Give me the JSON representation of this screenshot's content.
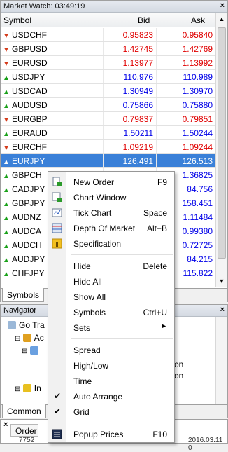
{
  "market_watch": {
    "title": "Market Watch: 03:49:19",
    "close": "×",
    "col_symbol": "Symbol",
    "col_bid": "Bid",
    "col_ask": "Ask",
    "rows": [
      {
        "symbol": "USDCHF",
        "bid": "0.95823",
        "ask": "0.95840",
        "dir": "down"
      },
      {
        "symbol": "GBPUSD",
        "bid": "1.42745",
        "ask": "1.42769",
        "dir": "down"
      },
      {
        "symbol": "EURUSD",
        "bid": "1.13977",
        "ask": "1.13992",
        "dir": "down"
      },
      {
        "symbol": "USDJPY",
        "bid": "110.976",
        "ask": "110.989",
        "dir": "up"
      },
      {
        "symbol": "USDCAD",
        "bid": "1.30949",
        "ask": "1.30970",
        "dir": "up"
      },
      {
        "symbol": "AUDUSD",
        "bid": "0.75866",
        "ask": "0.75880",
        "dir": "up"
      },
      {
        "symbol": "EURGBP",
        "bid": "0.79837",
        "ask": "0.79851",
        "dir": "down"
      },
      {
        "symbol": "EURAUD",
        "bid": "1.50211",
        "ask": "1.50244",
        "dir": "up"
      },
      {
        "symbol": "EURCHF",
        "bid": "1.09219",
        "ask": "1.09244",
        "dir": "down"
      },
      {
        "symbol": "EURJPY",
        "bid": "126.491",
        "ask": "126.513",
        "dir": "up"
      },
      {
        "symbol": "GBPCH",
        "bid": "",
        "ask": "1.36825",
        "dir": "up"
      },
      {
        "symbol": "CADJPY",
        "bid": "",
        "ask": "84.756",
        "dir": "up"
      },
      {
        "symbol": "GBPJPY",
        "bid": "",
        "ask": "158.451",
        "dir": "up"
      },
      {
        "symbol": "AUDNZ",
        "bid": "",
        "ask": "1.11484",
        "dir": "up"
      },
      {
        "symbol": "AUDCA",
        "bid": "",
        "ask": "0.99380",
        "dir": "up"
      },
      {
        "symbol": "AUDCH",
        "bid": "",
        "ask": "0.72725",
        "dir": "up"
      },
      {
        "symbol": "AUDJPY",
        "bid": "",
        "ask": "84.215",
        "dir": "up"
      },
      {
        "symbol": "CHFJPY",
        "bid": "",
        "ask": "115.822",
        "dir": "up"
      }
    ],
    "tab_symbols": "Symbols"
  },
  "navigator": {
    "title": "Navigator",
    "close": "×",
    "item_go": "Go Tra",
    "item_ac": "Ac",
    "item_in": "In",
    "frag1": "on",
    "frag2": "on",
    "tab_common": "Common"
  },
  "terminal": {
    "close": "×",
    "tab_order": "Order",
    "ticket": "7752",
    "time": "2016.03.11 0"
  },
  "context_menu": {
    "items": [
      {
        "label": "New Order",
        "shortcut": "F9"
      },
      {
        "label": "Chart Window",
        "shortcut": ""
      },
      {
        "label": "Tick Chart",
        "shortcut": "Space"
      },
      {
        "label": "Depth Of Market",
        "shortcut": "Alt+B"
      },
      {
        "label": "Specification",
        "shortcut": ""
      },
      {
        "label": "Hide",
        "shortcut": "Delete"
      },
      {
        "label": "Hide All",
        "shortcut": ""
      },
      {
        "label": "Show All",
        "shortcut": ""
      },
      {
        "label": "Symbols",
        "shortcut": "Ctrl+U"
      },
      {
        "label": "Sets",
        "shortcut": ""
      },
      {
        "label": "Spread",
        "shortcut": ""
      },
      {
        "label": "High/Low",
        "shortcut": ""
      },
      {
        "label": "Time",
        "shortcut": ""
      },
      {
        "label": "Auto Arrange",
        "shortcut": "",
        "checked": true
      },
      {
        "label": "Grid",
        "shortcut": "",
        "checked": true
      },
      {
        "label": "Popup Prices",
        "shortcut": "F10"
      }
    ]
  },
  "colors": {
    "up": "#0000e8",
    "down": "#e00000",
    "selected": "#3a80d8"
  }
}
